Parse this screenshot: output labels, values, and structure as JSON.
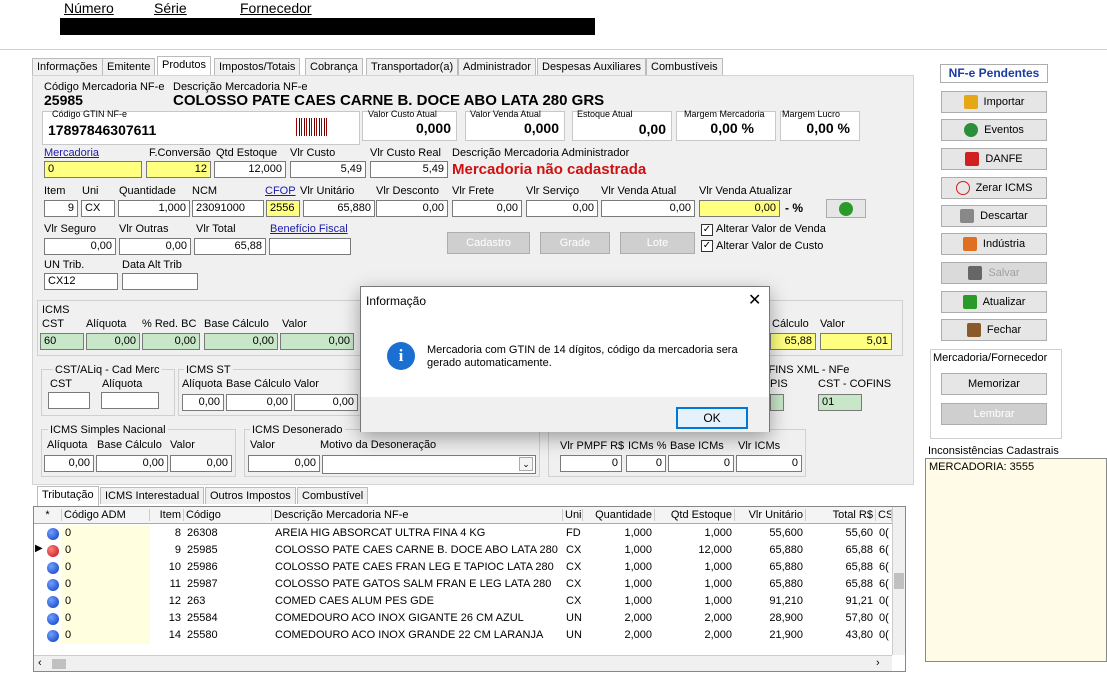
{
  "header": {
    "numero": "Número",
    "serie": "Série",
    "fornecedor": "Fornecedor"
  },
  "tabs": [
    "Informações",
    "Emitente",
    "Produtos",
    "Impostos/Totais",
    "Cobrança",
    "Transportador(a)",
    "Administrador",
    "Despesas Auxiliares",
    "Combustíveis"
  ],
  "product": {
    "cod_label": "Código Mercadoria NF-e",
    "cod": "25985",
    "desc_label": "Descrição Mercadoria NF-e",
    "desc": "COLOSSO PATE CAES CARNE B. DOCE ABO LATA 280 GRS",
    "gtin_label": "Código GTIN NF-e",
    "gtin": "17897846307611",
    "custo_label": "Valor Custo Atual",
    "custo": "0,000",
    "venda_label": "Valor Venda Atual",
    "venda": "0,000",
    "estoque_label": "Estoque Atual",
    "estoque": "0,00",
    "margem_merc_label": "Margem Mercadoria",
    "margem_merc": "0,00 %",
    "margem_lucro_label": "Margem Lucro",
    "margem_lucro": "0,00 %"
  },
  "row1": {
    "mercadoria_label": "Mercadoria",
    "mercadoria": "0",
    "fconv_label": "F.Conversão",
    "fconv": "12",
    "qtdest_label": "Qtd Estoque",
    "qtdest": "12,000",
    "vcusto_label": "Vlr Custo",
    "vcusto": "5,49",
    "vcustoreal_label": "Vlr Custo Real",
    "vcustoreal": "5,49",
    "descadm_label": "Descrição Mercadoria Administrador",
    "descadm": "Mercadoria não cadastrada"
  },
  "row2": {
    "item_label": "Item",
    "item": "9",
    "uni_label": "Uni",
    "uni": "CX",
    "qtd_label": "Quantidade",
    "qtd": "1,000",
    "ncm_label": "NCM",
    "ncm": "23091000",
    "cfop_label": "CFOP",
    "cfop": "2556",
    "vunit_label": "Vlr Unitário",
    "vunit": "65,880",
    "vdesc_label": "Vlr Desconto",
    "vdesc": "0,00",
    "vfrete_label": "Vlr Frete",
    "vfrete": "0,00",
    "vserv_label": "Vlr Serviço",
    "vserv": "0,00",
    "vvenda_label": "Vlr Venda Atual",
    "vvenda": "0,00",
    "vvatu_label": "Vlr Venda Atualizar",
    "vvatu": "0,00",
    "pct": "- %"
  },
  "row3": {
    "vseg_label": "Vlr Seguro",
    "vseg": "0,00",
    "vout_label": "Vlr Outras",
    "vout": "0,00",
    "vtot_label": "Vlr Total",
    "vtot": "65,88",
    "benef_label": "Benefício Fiscal",
    "btn_cadastro": "Cadastro",
    "btn_grade": "Grade",
    "btn_lote": "Lote",
    "chk_venda": "Alterar Valor de Venda",
    "chk_custo": "Alterar Valor de Custo"
  },
  "row4": {
    "untrib_label": "UN Trib.",
    "untrib": "CX12",
    "datatrib_label": "Data Alt Trib"
  },
  "icms": {
    "title": "ICMS",
    "cst_label": "CST",
    "cst": "60",
    "aliq_label": "Alíquota",
    "aliq": "0,00",
    "red_label": "% Red. BC",
    "red": "0,00",
    "base_label": "Base Cálculo",
    "base": "0,00",
    "valor_label": "Valor",
    "valor": "0,00",
    "r_base_label": "Cálculo",
    "r_base": "65,88",
    "r_valor_label": "Valor",
    "r_valor": "5,01"
  },
  "cstaliq": {
    "title": "CST/ALiq - Cad Merc",
    "cst_label": "CST",
    "aliq_label": "Alíquota"
  },
  "icmsst": {
    "title": "ICMS ST",
    "aliq_label": "Alíquota",
    "base_label": "Base Cálculo",
    "valor_label": "Valor",
    "aliq": "0,00",
    "base": "0,00",
    "valor": "0,00"
  },
  "cofins": {
    "title": "COFINS XML - NFe",
    "pis_label": "PIS",
    "cst_label": "CST - COFINS",
    "cst": "01"
  },
  "simples": {
    "title": "ICMS Simples Nacional",
    "aliq_label": "Alíquota",
    "base_label": "Base Cálculo",
    "valor_label": "Valor",
    "aliq": "0,00",
    "base": "0,00",
    "valor": "0,00"
  },
  "deson": {
    "title": "ICMS Desonerado",
    "valor_label": "Valor",
    "motivo_label": "Motivo da Desoneração",
    "valor": "0,00"
  },
  "pmpf": {
    "pmpf_label": "Vlr PMPF R$",
    "icms_label": "ICMs %",
    "base_label": "Base ICMs",
    "vicms_label": "Vlr ICMs",
    "pmpf": "0",
    "icms": "0",
    "base": "0",
    "vicms": "0"
  },
  "subtabs": [
    "Tributação",
    "ICMS Interestadual",
    "Outros Impostos",
    "Combustível"
  ],
  "grid": {
    "headers": [
      "*",
      "Código ADM",
      "Item",
      "Código",
      "Descrição Mercadoria NF-e",
      "Uni",
      "Quantidade",
      "Qtd Estoque",
      "Vlr Unitário",
      "Total R$",
      "CS"
    ],
    "rows": [
      [
        "0",
        "8",
        "26308",
        "AREIA HIG ABSORCAT ULTRA FINA 4 KG",
        "FD",
        "1,000",
        "1,000",
        "55,600",
        "55,60",
        "0("
      ],
      [
        "0",
        "9",
        "25985",
        "COLOSSO PATE CAES CARNE B. DOCE ABO LATA 280",
        "CX",
        "1,000",
        "12,000",
        "65,880",
        "65,88",
        "6("
      ],
      [
        "0",
        "10",
        "25986",
        "COLOSSO PATE CAES FRAN LEG E TAPIOC LATA 280",
        "CX",
        "1,000",
        "1,000",
        "65,880",
        "65,88",
        "6("
      ],
      [
        "0",
        "11",
        "25987",
        "COLOSSO PATE GATOS SALM FRAN E LEG LATA 280",
        "CX",
        "1,000",
        "1,000",
        "65,880",
        "65,88",
        "6("
      ],
      [
        "0",
        "12",
        "263",
        "COMED CAES ALUM PES GDE",
        "CX",
        "1,000",
        "1,000",
        "91,210",
        "91,21",
        "0("
      ],
      [
        "0",
        "13",
        "25584",
        "COMEDOURO ACO INOX GIGANTE 26 CM AZUL",
        "UN",
        "2,000",
        "2,000",
        "28,900",
        "57,80",
        "0("
      ],
      [
        "0",
        "14",
        "25580",
        "COMEDOURO ACO INOX GRANDE 22 CM LARANJA",
        "UN",
        "2,000",
        "2,000",
        "21,900",
        "43,80",
        "0("
      ]
    ]
  },
  "sidebar": {
    "title": "NF-e Pendentes",
    "importar": "Importar",
    "eventos": "Eventos",
    "danfe": "DANFE",
    "zerar": "Zerar ICMS",
    "descartar": "Descartar",
    "industria": "Indústria",
    "salvar": "Salvar",
    "atualizar": "Atualizar",
    "fechar": "Fechar",
    "merc_forn": "Mercadoria/Fornecedor",
    "memorizar": "Memorizar",
    "lembrar": "Lembrar",
    "incons_label": "Inconsistências Cadastrais",
    "incons_text": "MERCADORIA: 3555"
  },
  "dialog": {
    "title": "Informação",
    "message": "Mercadoria com GTIN de 14 dígitos, código da mercadoria sera gerado automaticamente.",
    "ok": "OK"
  }
}
